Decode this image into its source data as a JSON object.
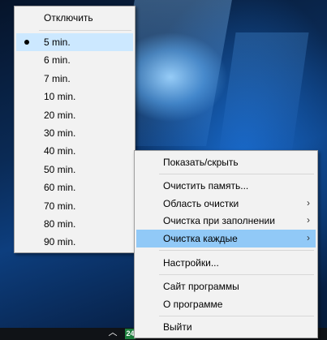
{
  "submenu": {
    "disable_label": "Отключить",
    "items": [
      {
        "label": "5 min.",
        "checked": true
      },
      {
        "label": "6 min."
      },
      {
        "label": "7 min."
      },
      {
        "label": "10 min."
      },
      {
        "label": "20 min."
      },
      {
        "label": "30 min."
      },
      {
        "label": "40 min."
      },
      {
        "label": "50 min."
      },
      {
        "label": "60 min."
      },
      {
        "label": "70 min."
      },
      {
        "label": "80 min."
      },
      {
        "label": "90 min."
      }
    ]
  },
  "menu": {
    "show_hide": "Показать/скрыть",
    "clean_memory": "Очистить память...",
    "clean_area": "Область очистки",
    "clean_on_fill": "Очистка при заполнении",
    "clean_every": "Очистка каждые",
    "settings": "Настройки...",
    "website": "Сайт программы",
    "about": "О программе",
    "exit": "Выйти"
  },
  "taskbar": {
    "tray_app_badge": "24",
    "submenu_arrow": "›"
  },
  "colors": {
    "menu_bg": "#f2f2f2",
    "highlight": "#91c9f7",
    "checked_bg": "#cce8ff"
  }
}
